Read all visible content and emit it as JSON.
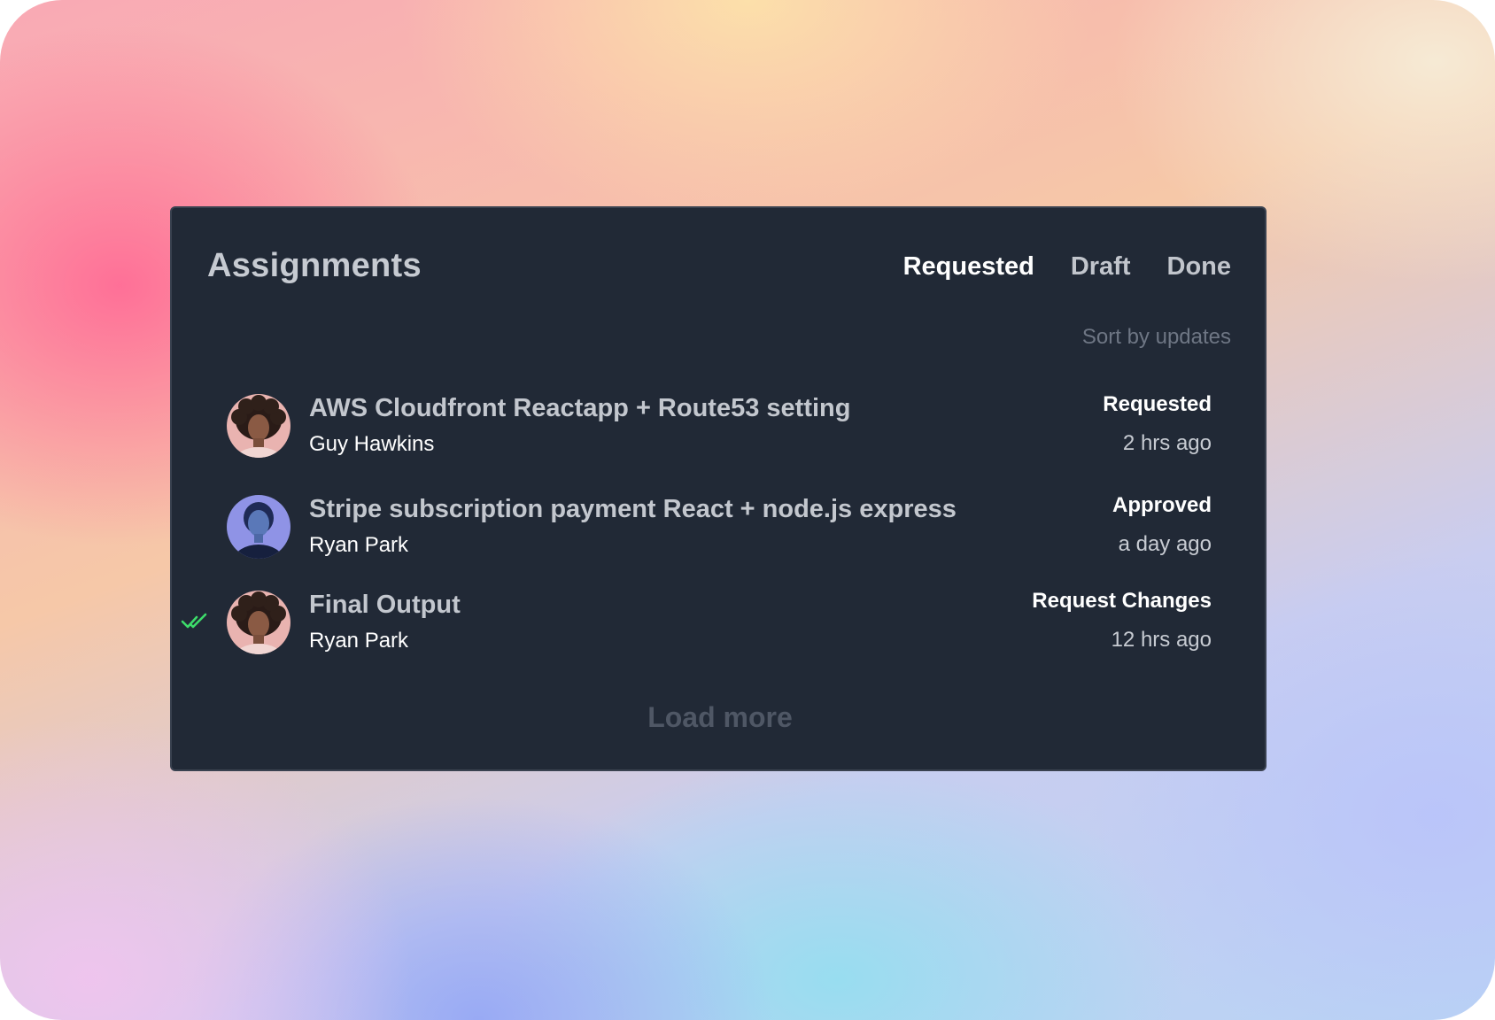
{
  "header": {
    "title": "Assignments",
    "tabs": [
      {
        "label": "Requested",
        "active": true
      },
      {
        "label": "Draft",
        "active": false
      },
      {
        "label": "Done",
        "active": false
      }
    ]
  },
  "sort": {
    "label": "Sort by updates"
  },
  "assignments": [
    {
      "title": "AWS Cloudfront Reactapp + Route53 setting",
      "author": "Guy Hawkins",
      "status": "Requested",
      "time": "2 hrs ago",
      "avatar": "avatar-curly-hair",
      "checked": false
    },
    {
      "title": "Stripe subscription payment React + node.js express",
      "author": "Ryan Park",
      "status": "Approved",
      "time": "a day ago",
      "avatar": "avatar-blue-light",
      "checked": false
    },
    {
      "title": "Final Output",
      "author": "Ryan Park",
      "status": "Request Changes",
      "time": "12 hrs ago",
      "avatar": "avatar-curly-hair",
      "checked": true
    }
  ],
  "footer": {
    "load_more_label": "Load more"
  },
  "colors": {
    "card_background": "#212936",
    "check_icon": "#3ddc6a"
  }
}
